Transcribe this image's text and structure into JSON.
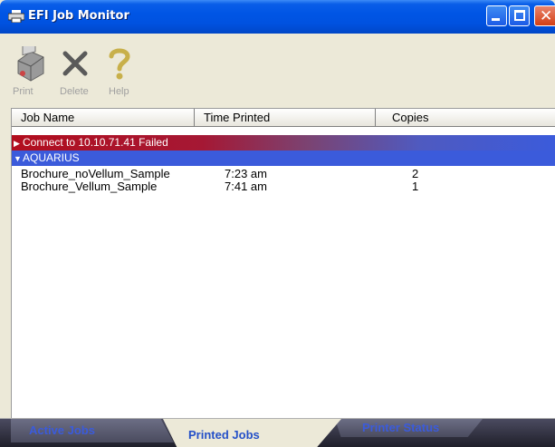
{
  "window": {
    "title": "EFI Job Monitor"
  },
  "toolbar": {
    "print_label": "Print",
    "delete_label": "Delete",
    "help_label": "Help"
  },
  "columns": [
    "Job Name",
    "Time Printed",
    "Copies"
  ],
  "groups": {
    "error": {
      "label": "Connect to 10.10.71.41 Failed",
      "color": "#b20e1e"
    },
    "printer": {
      "label": "AQUARIUS",
      "color": "#3b5bdb"
    }
  },
  "jobs": [
    {
      "name": "Brochure_noVellum_Sample",
      "time": "7:23 am",
      "copies": "2"
    },
    {
      "name": "Brochure_Vellum_Sample",
      "time": "7:41 am",
      "copies": "1"
    }
  ],
  "tabs": {
    "active_jobs": "Active Jobs",
    "printed_jobs": "Printed Jobs",
    "printer_status": "Printer Status",
    "selected": "Printed Jobs"
  },
  "icons": {
    "title": "printer-icon",
    "print": "printer-icon",
    "delete": "x-icon",
    "help": "question-mark-icon",
    "collapsed": "triangle-right-icon",
    "expanded": "triangle-down-icon"
  }
}
